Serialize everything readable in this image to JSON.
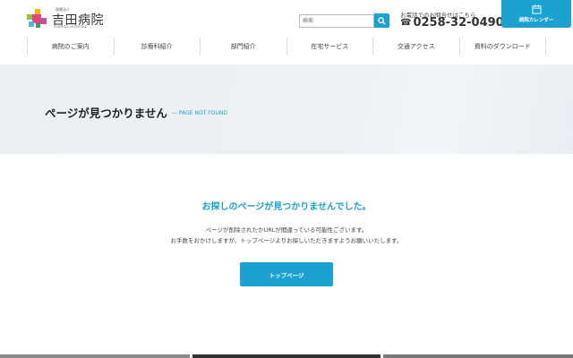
{
  "header": {
    "logo_small": "医療法人",
    "logo_title": "吉田病院",
    "logo_sub": "YOSHIDA HOSPITAL",
    "search_placeholder": "検索",
    "phone_label": "お電話でのお問合せはこちら",
    "phone_number": "0258-32-0490",
    "calendar_label": "病院カレンダー"
  },
  "nav": [
    {
      "label": "病院のご案内"
    },
    {
      "label": "診療科紹介"
    },
    {
      "label": "部門紹介"
    },
    {
      "label": "在宅サービス"
    },
    {
      "label": "交通アクセス"
    },
    {
      "label": "資料のダウンロード"
    }
  ],
  "hero": {
    "title": "ページが見つかりません",
    "subtitle": "— PAGE NOT FOUND"
  },
  "main": {
    "message": "お探しのページが見つかりませんでした。",
    "line1": "ページが削除されたかURLが間違っている可能性ございます。",
    "line2": "お手数をおかけしますが、トップページよりお探しいただきますようお願いいたします。",
    "button": "トップページ"
  },
  "colors": {
    "accent": "#1ba2d1"
  }
}
